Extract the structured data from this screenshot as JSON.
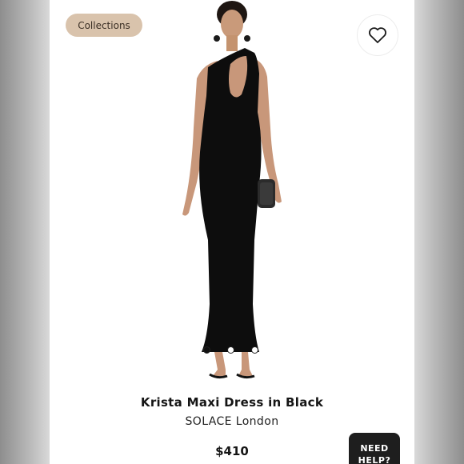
{
  "header": {
    "collections_label": "Collections",
    "favorite_icon": "heart-icon"
  },
  "carousel": {
    "image": "product-photo",
    "dots": 3,
    "active_dot": 0
  },
  "product": {
    "title": "Krista Maxi Dress in Black",
    "brand": "SOLACE London",
    "price": "$410"
  },
  "help": {
    "line1": "NEED",
    "line2": "HELP?"
  },
  "colors": {
    "chip_bg": "#d9c3ac",
    "help_bg": "#1e1e1e",
    "dress": "#0d0d0d"
  }
}
